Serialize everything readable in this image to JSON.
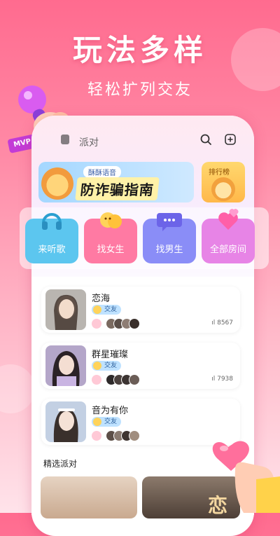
{
  "hero": {
    "title": "玩法多样",
    "subtitle": "轻松扩列交友"
  },
  "header": {
    "title": "派对",
    "icons": [
      "search-icon",
      "add-room-icon"
    ]
  },
  "banner": {
    "brand": "酥酥语音",
    "headline": "防诈骗指南"
  },
  "rank": {
    "label": "排行榜"
  },
  "categories": [
    {
      "label": "来听歌",
      "color": "#5cc6ef",
      "icon": "headphones-icon"
    },
    {
      "label": "找女生",
      "color": "#ff7aa3",
      "icon": "emoji-faces-icon"
    },
    {
      "label": "找男生",
      "color": "#8a8df7",
      "icon": "chat-bubble-icon"
    },
    {
      "label": "全部房间",
      "color": "#e784e6",
      "icon": "hearts-icon"
    }
  ],
  "rooms": [
    {
      "name": "恋海",
      "tag": "交友",
      "count": "8567"
    },
    {
      "name": "群星璀璨",
      "tag": "交友",
      "count": "7938"
    },
    {
      "name": "音为有你",
      "tag": "交友",
      "count": ""
    }
  ],
  "featured": {
    "title": "精选派对",
    "glyph": "恋"
  },
  "decor": {
    "mvp_label": "MVP"
  }
}
